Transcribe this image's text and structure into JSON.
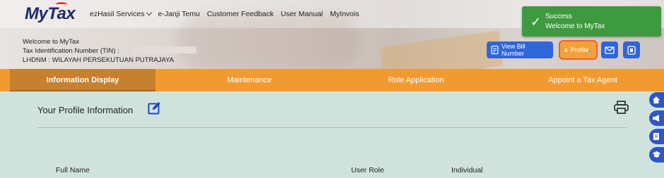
{
  "header": {
    "logo": "MyTax",
    "nav": [
      {
        "label": "ezHasil Services"
      },
      {
        "label": "e-Janji Temu"
      },
      {
        "label": "Customer Feedback"
      },
      {
        "label": "User Manual"
      },
      {
        "label": "MyInvois"
      }
    ],
    "welcome_line1": "Welcome to MyTax",
    "welcome_line2": "Tax Identification Number (TIN) :",
    "welcome_line3": "LHDNM : WILAYAH PERSEKUTUAN PUTRAJAYA",
    "buttons": {
      "view_bill": "View Bill Number",
      "profile": "Profile"
    }
  },
  "toast": {
    "title": "Success",
    "message": "Welcome to MyTax"
  },
  "tabs": [
    {
      "label": "Information Display",
      "active": true
    },
    {
      "label": "Maintenance"
    },
    {
      "label": "Role Application"
    },
    {
      "label": "Appoint a Tax Agent"
    }
  ],
  "main": {
    "section_title": "Your Profile Information",
    "fields": {
      "full_name_label": "Full Name",
      "user_role_label": "User Role",
      "user_role_value": "Individual"
    }
  },
  "colors": {
    "tab_bar": "#f29a32",
    "active_tab": "#c7802f",
    "primary_button": "#2f66d8",
    "toast": "#3e9a3e",
    "content_bg": "#cfe3dc"
  }
}
